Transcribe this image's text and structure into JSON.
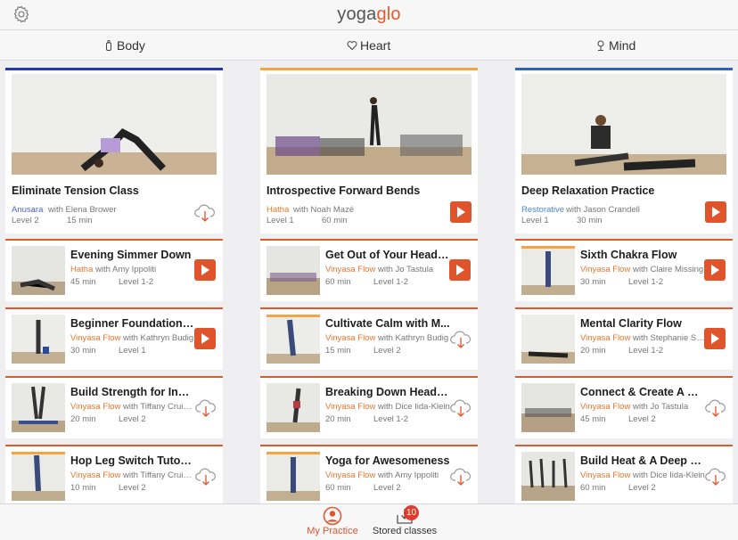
{
  "header": {
    "logo_part1": "yoga",
    "logo_part2": "glo"
  },
  "tabs": [
    {
      "label": "Body",
      "icon": "body-icon"
    },
    {
      "label": "Heart",
      "icon": "heart-icon"
    },
    {
      "label": "Mind",
      "icon": "mind-icon"
    }
  ],
  "columns": [
    {
      "featured": {
        "title": "Eliminate Tension Class",
        "style": "Anusara",
        "teacher": "with Elena Brower",
        "level": "Level 2",
        "duration": "15 min",
        "action": "download",
        "bar_color": "#2436b8",
        "style_color": "#4a63c8"
      },
      "rows": [
        {
          "title": "Evening Simmer Down",
          "style": "Hatha",
          "teacher": "with Amy Ippoliti",
          "duration": "45 min",
          "level": "Level 1-2",
          "action": "play",
          "thumb_bar": ""
        },
        {
          "title": "Beginner Foundation P...",
          "style": "Vinyasa Flow",
          "teacher": "with Kathryn Budig",
          "duration": "30 min",
          "level": "Level 1",
          "action": "play",
          "thumb_bar": ""
        },
        {
          "title": "Build Strength for Inve...",
          "style": "Vinyasa Flow",
          "teacher": "with Tiffany Cruiksh",
          "duration": "20 min",
          "level": "Level 2",
          "action": "download",
          "thumb_bar": ""
        },
        {
          "title": "Hop Leg Switch Tutorial",
          "style": "Vinyasa Flow",
          "teacher": "with Tiffany Cruiksh",
          "duration": "10 min",
          "level": "Level 2",
          "action": "download",
          "thumb_bar": "#f2a541"
        }
      ]
    },
    {
      "featured": {
        "title": "Introspective Forward Bends",
        "style": "Hatha",
        "teacher": "with Noah Mazé",
        "level": "Level 1",
        "duration": "60 min",
        "action": "play",
        "bar_color": "#f2a541",
        "style_color": "#e8762c"
      },
      "rows": [
        {
          "title": "Get Out of Your Head &...",
          "style": "Vinyasa Flow",
          "teacher": "with Jo Tastula",
          "duration": "60 min",
          "level": "Level 1-2",
          "action": "play",
          "thumb_bar": ""
        },
        {
          "title": "Cultivate Calm with M...",
          "style": "Vinyasa Flow",
          "teacher": "with Kathryn Budig",
          "duration": "15 min",
          "level": "Level 2",
          "action": "download",
          "thumb_bar": "#f2a541"
        },
        {
          "title": "Breaking Down Headst...",
          "style": "Vinyasa Flow",
          "teacher": "with Dice Iida-Klein",
          "duration": "20 min",
          "level": "Level 1-2",
          "action": "download",
          "thumb_bar": ""
        },
        {
          "title": "Yoga for Awesomeness",
          "style": "Vinyasa Flow",
          "teacher": "with Amy Ippoliti",
          "duration": "60 min",
          "level": "Level 2",
          "action": "download",
          "thumb_bar": "#f2a541"
        }
      ]
    },
    {
      "featured": {
        "title": "Deep Relaxation Practice",
        "style": "Restorative",
        "teacher": "with Jason Crandell",
        "level": "Level 1",
        "duration": "30 min",
        "action": "play",
        "bar_color": "#2f63b8",
        "style_color": "#4a86c8"
      },
      "rows": [
        {
          "title": "Sixth Chakra Flow",
          "style": "Vinyasa Flow",
          "teacher": "with Claire Missing",
          "duration": "30 min",
          "level": "Level 1-2",
          "action": "play",
          "thumb_bar": "#f2a541"
        },
        {
          "title": "Mental Clarity Flow",
          "style": "Vinyasa Flow",
          "teacher": "with Stephanie Sny...",
          "duration": "20 min",
          "level": "Level 1-2",
          "action": "play",
          "thumb_bar": ""
        },
        {
          "title": "Connect & Create A Be...",
          "style": "Vinyasa Flow",
          "teacher": "with Jo Tastula",
          "duration": "45 min",
          "level": "Level 2",
          "action": "download",
          "thumb_bar": ""
        },
        {
          "title": "Build Heat & A Deep Se...",
          "style": "Vinyasa Flow",
          "teacher": "with Dice Iida-Klein",
          "duration": "60 min",
          "level": "Level 2",
          "action": "download",
          "thumb_bar": ""
        }
      ]
    }
  ],
  "bottom_nav": {
    "my_practice": "My Practice",
    "stored_classes": "Stored classes",
    "stored_badge": "10"
  },
  "colors": {
    "accent": "#e0542c",
    "style_text": "#e8762c"
  }
}
